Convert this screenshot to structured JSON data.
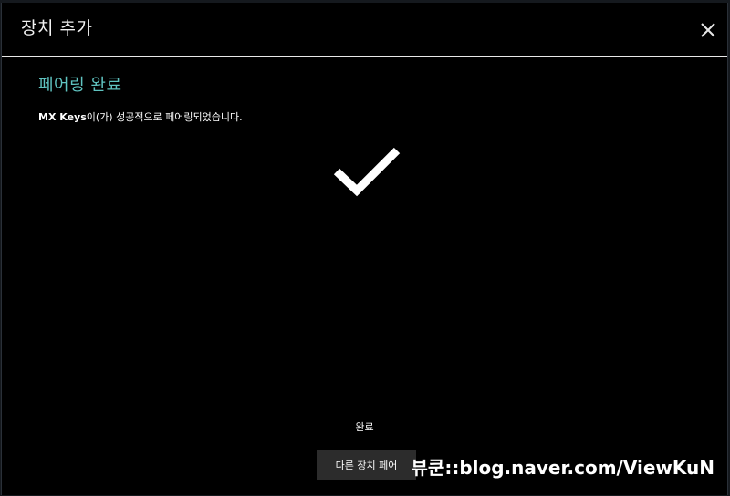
{
  "dialog": {
    "title": "장치 추가",
    "close_icon": "close-icon"
  },
  "content": {
    "heading": "페어링 완료",
    "heading_color": "#5fc3c0",
    "message_device": "MX Keys",
    "message_rest": "이(가) 성공적으로 페어링되었습니다.",
    "status_icon": "checkmark-icon"
  },
  "footer": {
    "done_label": "완료",
    "pair_another_label": "다른 장치 페어"
  },
  "watermark": "뷰쿤::blog.naver.com/ViewKuN"
}
